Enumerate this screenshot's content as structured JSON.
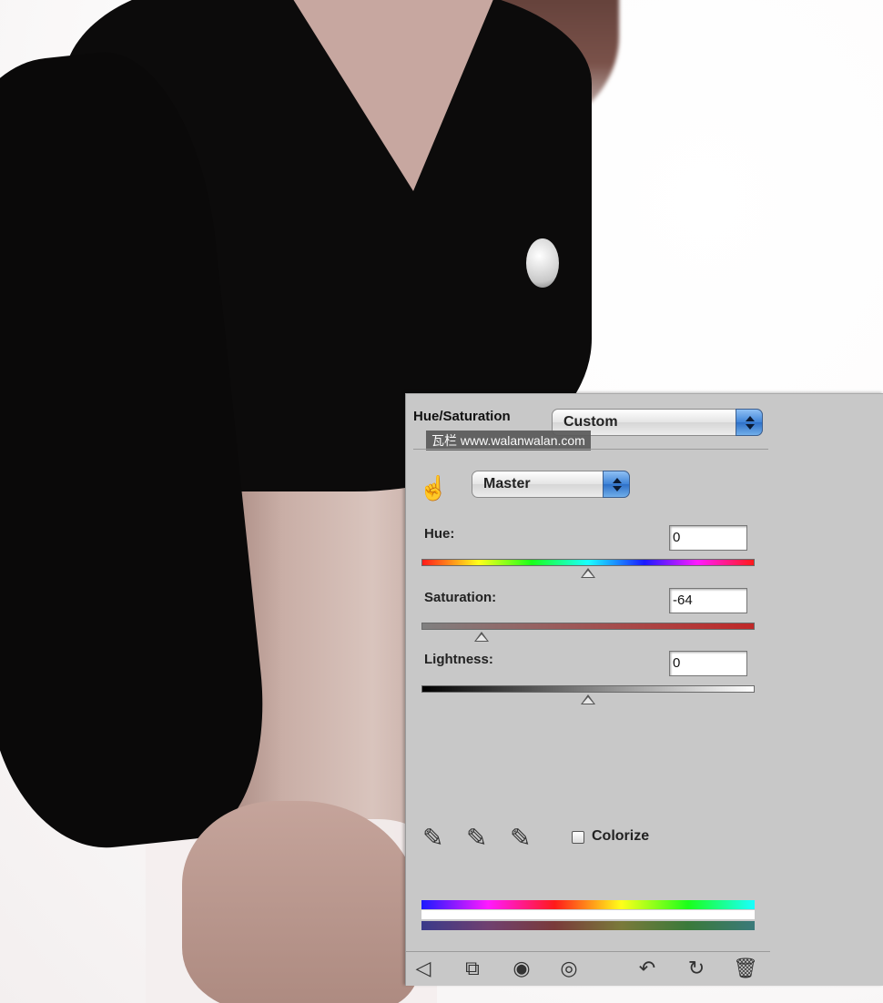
{
  "panel": {
    "title": "Hue/Saturation",
    "preset": {
      "value": "Custom"
    },
    "watermark": "瓦栏 www.walanwalan.com",
    "channel": {
      "value": "Master"
    },
    "hue": {
      "label": "Hue:",
      "value": "0",
      "slider_fraction": 0.5
    },
    "saturation": {
      "label": "Saturation:",
      "value": "-64",
      "slider_fraction": 0.18
    },
    "lightness": {
      "label": "Lightness:",
      "value": "0",
      "slider_fraction": 0.5
    },
    "colorize": {
      "label": "Colorize",
      "checked": false
    }
  },
  "icons": {
    "target_adjust": "hand-target-icon",
    "eyedroppers": [
      "eyedropper-icon",
      "eyedropper-plus-icon",
      "eyedropper-minus-icon"
    ],
    "bottom": [
      "return-arrow-icon",
      "clip-layer-icon",
      "eye-visibility-icon",
      "view-previous-icon",
      "reset-icon",
      "trash-icon"
    ]
  },
  "colors": {
    "panel_bg": "#c8c8c8",
    "popup_accent": "#3f84d8"
  }
}
